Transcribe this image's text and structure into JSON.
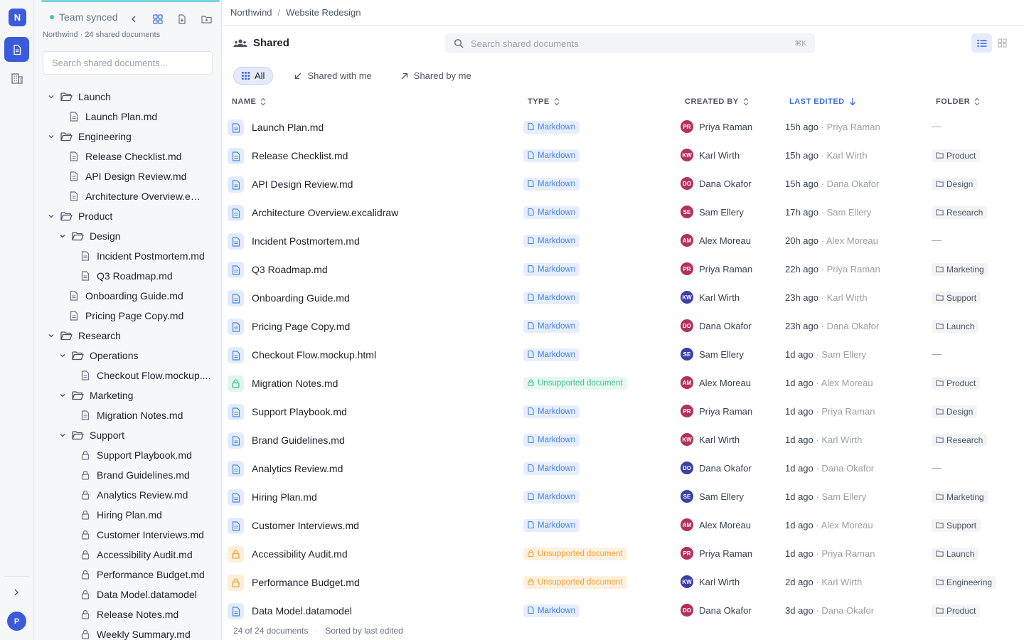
{
  "app": {
    "logo_letter": "N",
    "user_initial": "P",
    "accent": "#3b5bdb"
  },
  "sidebar": {
    "sync_status": "Team synced",
    "subtitle": "Northwind · 24 shared documents",
    "search_placeholder": "Search shared documents...",
    "tree": [
      {
        "label": "Launch",
        "kind": "folder",
        "depth": 0,
        "expanded": true
      },
      {
        "label": "Launch Plan.md",
        "kind": "doc",
        "depth": 1
      },
      {
        "label": "Engineering",
        "kind": "folder",
        "depth": 0,
        "expanded": true
      },
      {
        "label": "Release Checklist.md",
        "kind": "doc",
        "depth": 1
      },
      {
        "label": "API Design Review.md",
        "kind": "doc",
        "depth": 1
      },
      {
        "label": "Architecture Overview.exc...",
        "kind": "doc",
        "depth": 1
      },
      {
        "label": "Product",
        "kind": "folder",
        "depth": 0,
        "expanded": true
      },
      {
        "label": "Design",
        "kind": "folder",
        "depth": 1,
        "expanded": true
      },
      {
        "label": "Incident Postmortem.md",
        "kind": "doc",
        "depth": 2
      },
      {
        "label": "Q3 Roadmap.md",
        "kind": "doc",
        "depth": 2
      },
      {
        "label": "Onboarding Guide.md",
        "kind": "doc",
        "depth": 1
      },
      {
        "label": "Pricing Page Copy.md",
        "kind": "doc",
        "depth": 1
      },
      {
        "label": "Research",
        "kind": "folder",
        "depth": 0,
        "expanded": true
      },
      {
        "label": "Operations",
        "kind": "folder",
        "depth": 1,
        "expanded": true
      },
      {
        "label": "Checkout Flow.mockup....",
        "kind": "doc",
        "depth": 2
      },
      {
        "label": "Marketing",
        "kind": "folder",
        "depth": 1,
        "expanded": true
      },
      {
        "label": "Migration Notes.md",
        "kind": "doc",
        "depth": 2
      },
      {
        "label": "Support",
        "kind": "folder",
        "depth": 1,
        "expanded": true
      },
      {
        "label": "Support Playbook.md",
        "kind": "lock",
        "depth": 2
      },
      {
        "label": "Brand Guidelines.md",
        "kind": "lock",
        "depth": 2
      },
      {
        "label": "Analytics Review.md",
        "kind": "lock",
        "depth": 2
      },
      {
        "label": "Hiring Plan.md",
        "kind": "lock",
        "depth": 2
      },
      {
        "label": "Customer Interviews.md",
        "kind": "lock",
        "depth": 2
      },
      {
        "label": "Accessibility Audit.md",
        "kind": "lock",
        "depth": 2
      },
      {
        "label": "Performance Budget.md",
        "kind": "lock",
        "depth": 2
      },
      {
        "label": "Data Model.datamodel",
        "kind": "lock",
        "depth": 2
      },
      {
        "label": "Release Notes.md",
        "kind": "lock",
        "depth": 2
      },
      {
        "label": "Weekly Summary.md",
        "kind": "lock",
        "depth": 2
      }
    ]
  },
  "breadcrumb": {
    "org": "Northwind",
    "sep": "/",
    "project": "Website Redesign"
  },
  "header": {
    "title": "Shared",
    "search_placeholder": "Search shared documents",
    "search_shortcut": "⌘K"
  },
  "filters": [
    {
      "label": "All",
      "icon": "grid-icon",
      "active": true
    },
    {
      "label": "Shared with me",
      "icon": "arrow-down-left-icon",
      "active": false
    },
    {
      "label": "Shared by me",
      "icon": "arrow-up-right-icon",
      "active": false
    }
  ],
  "columns": {
    "name": "Name",
    "type": "Type",
    "created_by": "Created by",
    "last_edited": "Last edited",
    "folder": "Folder"
  },
  "rows": [
    {
      "name": "Launch Plan.md",
      "type": "Markdown",
      "kind": "md",
      "author": "Priya Raman",
      "initials": "PR",
      "avatar": "#b5305a",
      "edited": "15h ago",
      "editor": "Priya Raman",
      "folder": "—"
    },
    {
      "name": "Release Checklist.md",
      "type": "Markdown",
      "kind": "md",
      "author": "Karl Wirth",
      "initials": "KW",
      "avatar": "#b5305a",
      "edited": "15h ago",
      "editor": "Karl Wirth",
      "folder": "Product"
    },
    {
      "name": "API Design Review.md",
      "type": "Markdown",
      "kind": "md",
      "author": "Dana Okafor",
      "initials": "DO",
      "avatar": "#b5305a",
      "edited": "15h ago",
      "editor": "Dana Okafor",
      "folder": "Design"
    },
    {
      "name": "Architecture Overview.excalidraw",
      "type": "Markdown",
      "kind": "md",
      "author": "Sam Ellery",
      "initials": "SE",
      "avatar": "#b5305a",
      "edited": "17h ago",
      "editor": "Sam Ellery",
      "folder": "Research"
    },
    {
      "name": "Incident Postmortem.md",
      "type": "Markdown",
      "kind": "md",
      "author": "Alex Moreau",
      "initials": "AM",
      "avatar": "#b5305a",
      "edited": "20h ago",
      "editor": "Alex Moreau",
      "folder": "—"
    },
    {
      "name": "Q3 Roadmap.md",
      "type": "Markdown",
      "kind": "md",
      "author": "Priya Raman",
      "initials": "PR",
      "avatar": "#b5305a",
      "edited": "22h ago",
      "editor": "Priya Raman",
      "folder": "Marketing"
    },
    {
      "name": "Onboarding Guide.md",
      "type": "Markdown",
      "kind": "md",
      "author": "Karl Wirth",
      "initials": "KW",
      "avatar": "#3b3fa8",
      "edited": "23h ago",
      "editor": "Karl Wirth",
      "folder": "Support"
    },
    {
      "name": "Pricing Page Copy.md",
      "type": "Markdown",
      "kind": "md",
      "author": "Dana Okafor",
      "initials": "DO",
      "avatar": "#b5305a",
      "edited": "23h ago",
      "editor": "Dana Okafor",
      "folder": "Launch"
    },
    {
      "name": "Checkout Flow.mockup.html",
      "type": "Markdown",
      "kind": "md",
      "author": "Sam Ellery",
      "initials": "SE",
      "avatar": "#3b3fa8",
      "edited": "1d ago",
      "editor": "Sam Ellery",
      "folder": "—"
    },
    {
      "name": "Migration Notes.md",
      "type": "Unsupported document",
      "kind": "un-green",
      "author": "Alex Moreau",
      "initials": "AM",
      "avatar": "#b5305a",
      "edited": "1d ago",
      "editor": "Alex Moreau",
      "folder": "Product"
    },
    {
      "name": "Support Playbook.md",
      "type": "Markdown",
      "kind": "md",
      "author": "Priya Raman",
      "initials": "PR",
      "avatar": "#b5305a",
      "edited": "1d ago",
      "editor": "Priya Raman",
      "folder": "Design"
    },
    {
      "name": "Brand Guidelines.md",
      "type": "Markdown",
      "kind": "md",
      "author": "Karl Wirth",
      "initials": "KW",
      "avatar": "#b5305a",
      "edited": "1d ago",
      "editor": "Karl Wirth",
      "folder": "Research"
    },
    {
      "name": "Analytics Review.md",
      "type": "Markdown",
      "kind": "md",
      "author": "Dana Okafor",
      "initials": "DO",
      "avatar": "#3b3fa8",
      "edited": "1d ago",
      "editor": "Dana Okafor",
      "folder": "—"
    },
    {
      "name": "Hiring Plan.md",
      "type": "Markdown",
      "kind": "md",
      "author": "Sam Ellery",
      "initials": "SE",
      "avatar": "#3b3fa8",
      "edited": "1d ago",
      "editor": "Sam Ellery",
      "folder": "Marketing"
    },
    {
      "name": "Customer Interviews.md",
      "type": "Markdown",
      "kind": "md",
      "author": "Alex Moreau",
      "initials": "AM",
      "avatar": "#b5305a",
      "edited": "1d ago",
      "editor": "Alex Moreau",
      "folder": "Support"
    },
    {
      "name": "Accessibility Audit.md",
      "type": "Unsupported document",
      "kind": "un-orange",
      "author": "Priya Raman",
      "initials": "PR",
      "avatar": "#b5305a",
      "edited": "1d ago",
      "editor": "Priya Raman",
      "folder": "Launch"
    },
    {
      "name": "Performance Budget.md",
      "type": "Unsupported document",
      "kind": "un-orange",
      "author": "Karl Wirth",
      "initials": "KW",
      "avatar": "#3b3fa8",
      "edited": "2d ago",
      "editor": "Karl Wirth",
      "folder": "Engineering"
    },
    {
      "name": "Data Model.datamodel",
      "type": "Markdown",
      "kind": "md",
      "author": "Dana Okafor",
      "initials": "DO",
      "avatar": "#b5305a",
      "edited": "3d ago",
      "editor": "Dana Okafor",
      "folder": "Product"
    }
  ],
  "footer": {
    "count": "24 of 24 documents",
    "sort": "Sorted by last edited"
  }
}
